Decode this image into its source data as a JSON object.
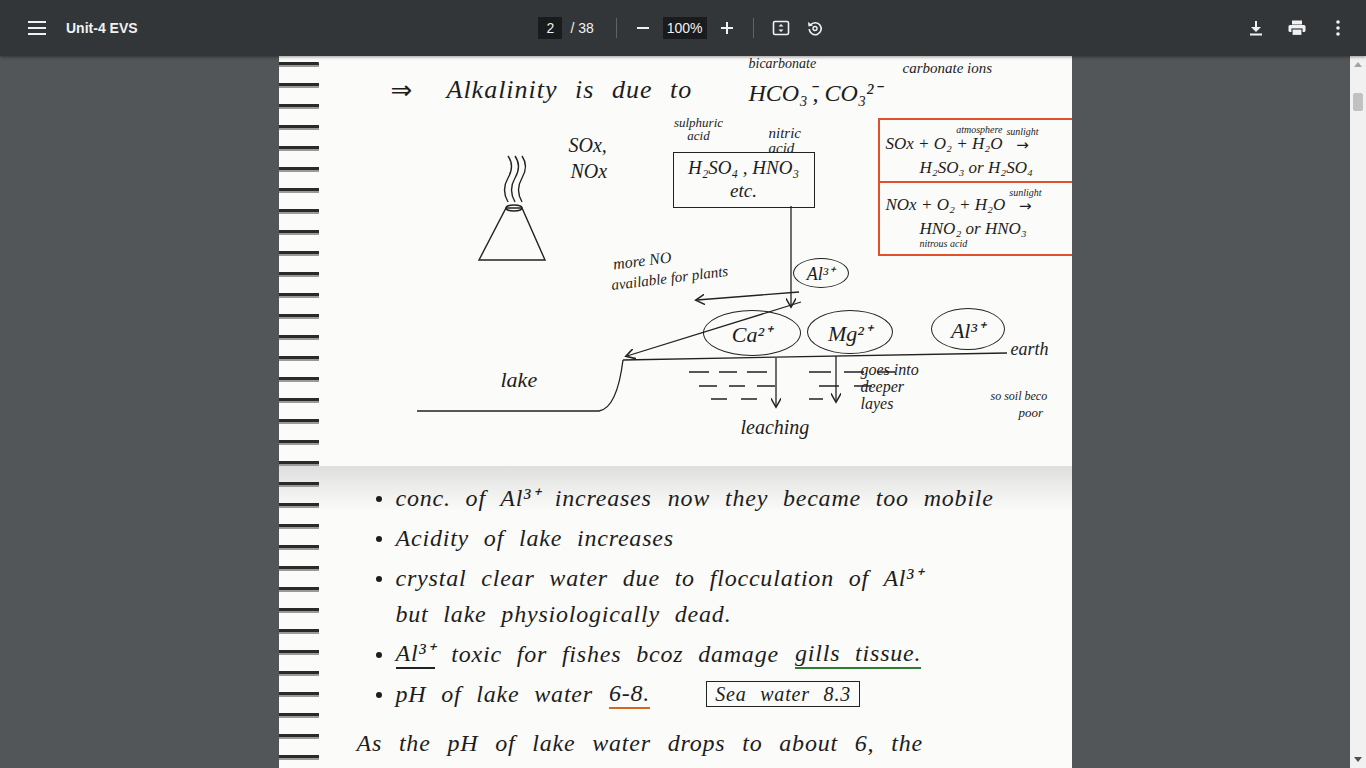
{
  "toolbar": {
    "title": "Unit-4 EVS",
    "page": "2",
    "page_count": "/ 38",
    "zoom": "100%"
  },
  "scrollbar": {
    "level": 0.03
  },
  "page": {
    "labels": {
      "arrow": "⇒",
      "alk": "Alkalinity is due to",
      "bicarb": "bicarbonate",
      "hco3": "HCO₃⁻",
      "co3": ", CO₃²⁻",
      "carbonate": "carbonate ions",
      "sox": "SOx,",
      "nox": "NOx",
      "sulphuric": "sulphuric acid",
      "nitric": "nitric acid",
      "more_no": "more NO",
      "more_no2": "available for plants",
      "earth": "earth",
      "lake": "lake",
      "leaching": "leaching",
      "deeper": "goes into deeper layes",
      "soil": "so soil beco",
      "poor": "poor"
    },
    "acids_box": {
      "line1": "H₂SO₄ , HNO₃",
      "line2": "etc."
    },
    "ions": {
      "al_top": "Al³⁺",
      "ca": "Ca²⁺",
      "mg": "Mg²⁺",
      "al": "Al³⁺"
    },
    "equations": [
      {
        "note": "atmosphere",
        "reactants": "SOx + O₂ + H₂O",
        "arrow": "→",
        "arrow_note": "sunlight",
        "products": "H₂SO₃ or H₂SO₄",
        "products_note": ""
      },
      {
        "note": "",
        "reactants": "NOx + O₂ + H₂O",
        "arrow": "→",
        "arrow_note": "sunlight",
        "products": "HNO₂ or HNO₃",
        "products_note": "nitrous acid"
      }
    ],
    "bullets": [
      {
        "lines": [
          [
            {
              "text": "conc. of Al³⁺ increases",
              "kind": "plain",
              "color": ""
            },
            {
              "text": "now they became too mobile",
              "kind": "plain",
              "color": ""
            }
          ]
        ]
      },
      {
        "lines": [
          [
            {
              "text": "Acidity of lake increases",
              "kind": "plain",
              "color": ""
            }
          ]
        ]
      },
      {
        "lines": [
          [
            {
              "text": "crystal clear water due to flocculation of Al³⁺",
              "kind": "plain",
              "color": ""
            }
          ],
          [
            {
              "text": "but lake physiologically dead.",
              "kind": "plain",
              "color": ""
            }
          ]
        ]
      },
      {
        "lines": [
          [
            {
              "text": "Al³⁺",
              "kind": "underline",
              "color": "#222222"
            },
            {
              "text": "toxic for fishes bcoz damage",
              "kind": "plain",
              "color": ""
            },
            {
              "text": "gills tissue.",
              "kind": "underline",
              "color": "#2e7d32"
            }
          ]
        ]
      },
      {
        "lines": [
          [
            {
              "text": "pH of lake water",
              "kind": "plain",
              "color": ""
            },
            {
              "text": "6-8.",
              "kind": "underline",
              "color": "#d2691e"
            },
            {
              "text": "Sea water 8.3",
              "kind": "boxed",
              "color": ""
            }
          ]
        ]
      }
    ],
    "last_line": "As the pH of lake water drops to about 6, the"
  }
}
